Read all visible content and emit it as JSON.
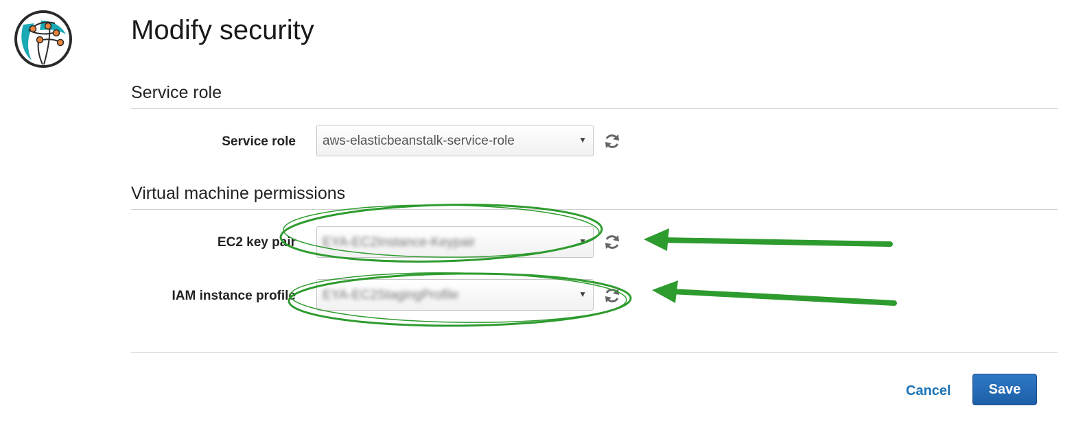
{
  "app": {
    "logo_icon": "elastic-beanstalk-logo-icon"
  },
  "header": {
    "title": "Modify security"
  },
  "sections": {
    "service_role": {
      "heading": "Service role",
      "field_label": "Service role",
      "selected_value": "aws-elasticbeanstalk-service-role"
    },
    "vm_permissions": {
      "heading": "Virtual machine permissions",
      "key_pair_label": "EC2 key pair",
      "key_pair_value": "EYA-EC2Instance-Keypair",
      "instance_profile_label": "IAM instance profile",
      "instance_profile_value": "EYA-EC2StagingProfile"
    }
  },
  "footer": {
    "cancel_label": "Cancel",
    "save_label": "Save"
  },
  "colors": {
    "accent_link": "#1a73b8",
    "save_button": "#1d5fa8",
    "annotation_green": "#2e9b2e"
  },
  "icons": {
    "refresh": "refresh-icon",
    "caret": "caret-down-icon",
    "arrow": "arrow-left-annotation"
  }
}
